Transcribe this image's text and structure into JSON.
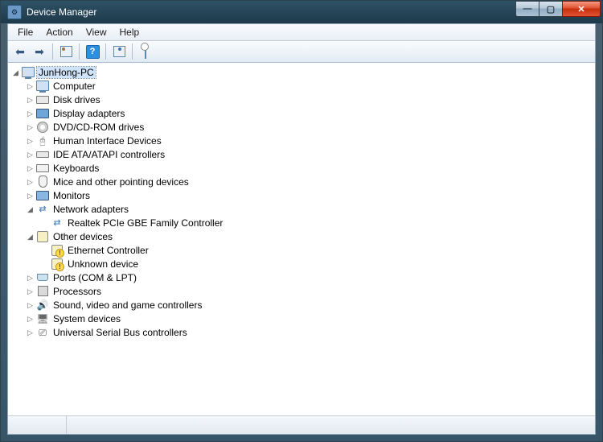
{
  "window": {
    "title": "Device Manager"
  },
  "menu": {
    "file": "File",
    "action": "Action",
    "view": "View",
    "help": "Help"
  },
  "tree": {
    "root": "JunHong-PC",
    "computer": "Computer",
    "disk": "Disk drives",
    "display": "Display adapters",
    "dvd": "DVD/CD-ROM drives",
    "hid": "Human Interface Devices",
    "ide": "IDE ATA/ATAPI controllers",
    "keyboards": "Keyboards",
    "mice": "Mice and other pointing devices",
    "monitors": "Monitors",
    "network": "Network adapters",
    "network_children": {
      "realtek": "Realtek PCIe GBE Family Controller"
    },
    "other": "Other devices",
    "other_children": {
      "ethernet": "Ethernet Controller",
      "unknown": "Unknown device"
    },
    "ports": "Ports (COM & LPT)",
    "processors": "Processors",
    "sound": "Sound, video and game controllers",
    "system": "System devices",
    "usb": "Universal Serial Bus controllers"
  }
}
